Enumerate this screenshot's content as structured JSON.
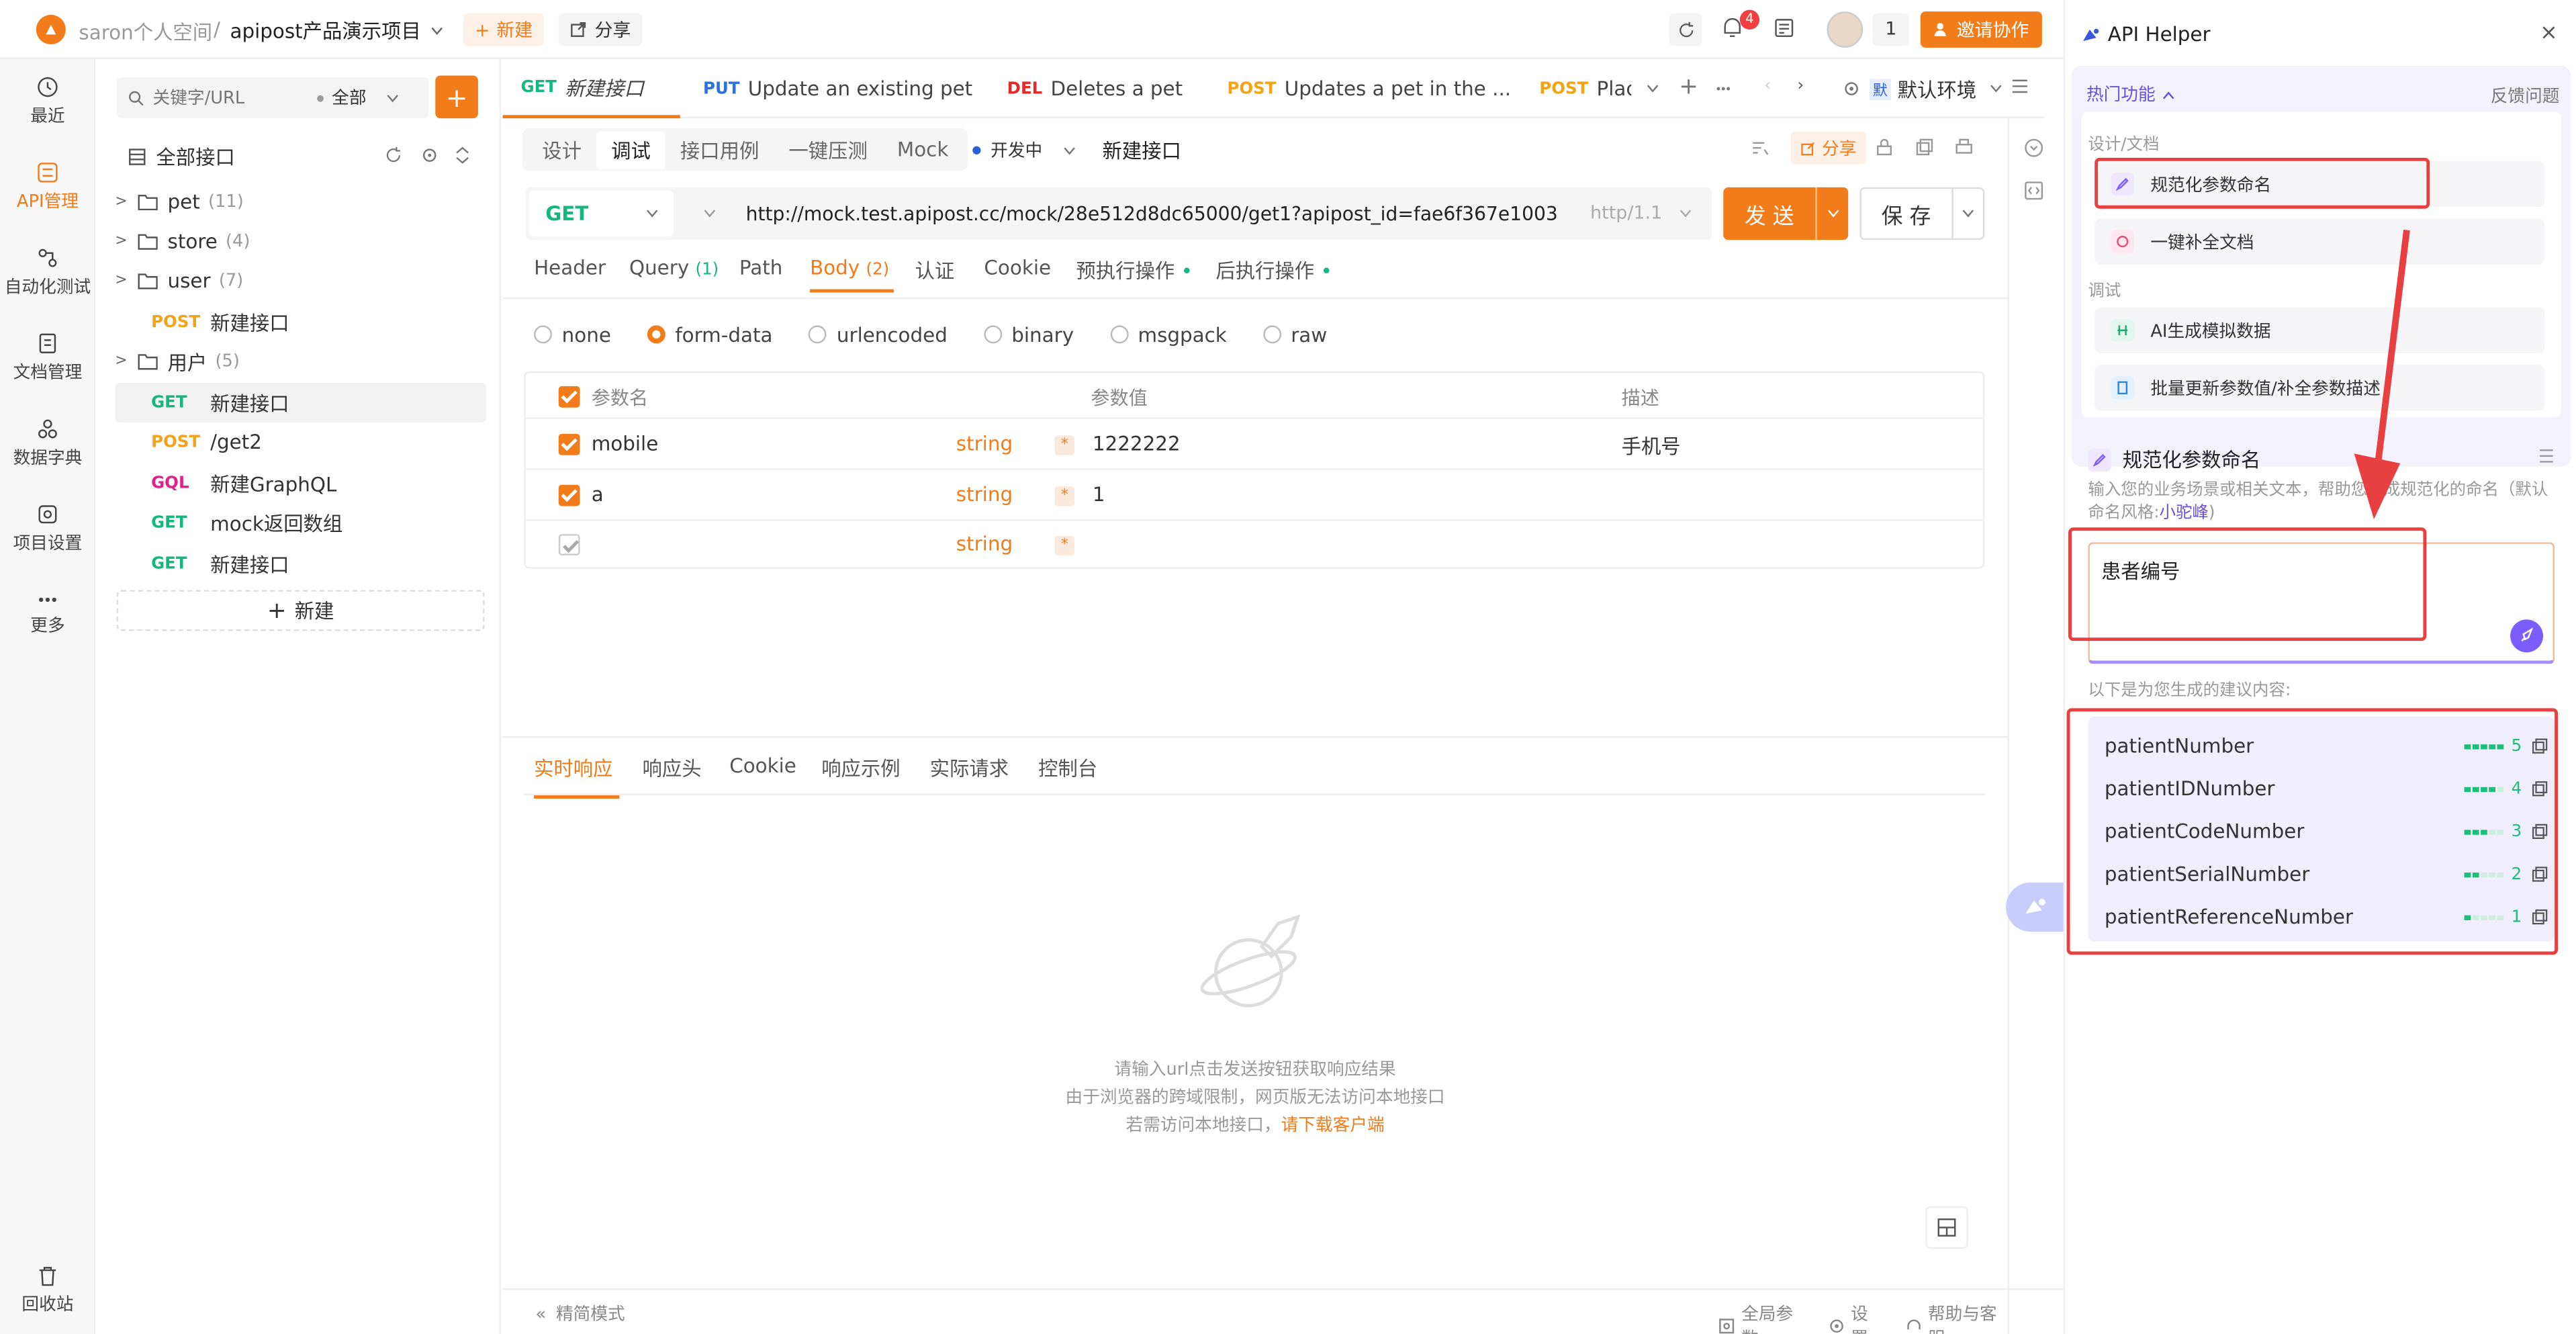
{
  "topbar": {
    "workspace": "saron个人空间",
    "sep": "/",
    "project": "apipost产品演示项目",
    "new_label": "新建",
    "share_label": "分享",
    "notify_count": "4",
    "member_count": "1",
    "invite_label": "邀请协作"
  },
  "sidebar": {
    "items": [
      {
        "label": "最近"
      },
      {
        "label": "API管理"
      },
      {
        "label": "自动化测试"
      },
      {
        "label": "文档管理"
      },
      {
        "label": "数据字典"
      },
      {
        "label": "项目设置"
      },
      {
        "label": "更多"
      }
    ],
    "trash": "回收站"
  },
  "tree": {
    "search_placeholder": "关键字/URL",
    "filter": "全部",
    "root": "全部接口",
    "rows": [
      {
        "name": "pet",
        "count": "(11)"
      },
      {
        "name": "store",
        "count": "(4)"
      },
      {
        "name": "user",
        "count": "(7)"
      },
      {
        "method": "POST",
        "name": "新建接口"
      },
      {
        "name": "用户",
        "count": "(5)"
      },
      {
        "method": "GET",
        "name": "新建接口"
      },
      {
        "method": "POST",
        "name": "/get2"
      },
      {
        "method": "GQL",
        "name": "新建GraphQL"
      },
      {
        "method": "GET",
        "name": "mock返回数组"
      },
      {
        "method": "GET",
        "name": "新建接口"
      }
    ],
    "new_label": "新建"
  },
  "tabs": [
    {
      "method": "GET",
      "name": "新建接口"
    },
    {
      "method": "PUT",
      "name": "Update an existing pet"
    },
    {
      "method": "DEL",
      "name": "Deletes a pet"
    },
    {
      "method": "POST",
      "name": "Updates a pet in the ..."
    },
    {
      "method": "POST",
      "name": "Plac"
    }
  ],
  "env": "默认环境",
  "subtabs": [
    "设计",
    "调试",
    "接口用例",
    "一键压测",
    "Mock"
  ],
  "status": "开发中",
  "api_name": "新建接口",
  "share_label": "分享",
  "request": {
    "method": "GET",
    "url": "http://mock.test.apipost.cc/mock/28e512d8dc65000/get1?apipost_id=fae6f367e1003",
    "protocol": "http/1.1",
    "send": "发 送",
    "save": "保 存"
  },
  "params_tabs": [
    {
      "label": "Header"
    },
    {
      "label": "Query",
      "count": "(1)"
    },
    {
      "label": "Path"
    },
    {
      "label": "Body",
      "count": "(2)"
    },
    {
      "label": "认证"
    },
    {
      "label": "Cookie"
    },
    {
      "label": "预执行操作"
    },
    {
      "label": "后执行操作"
    }
  ],
  "body_types": [
    "none",
    "form-data",
    "urlencoded",
    "binary",
    "msgpack",
    "raw"
  ],
  "table": {
    "headers": [
      "参数名",
      "参数值",
      "描述"
    ],
    "rows": [
      {
        "name": "mobile",
        "type": "string",
        "value": "1222222",
        "desc": "手机号"
      },
      {
        "name": "a",
        "type": "string",
        "value": "1",
        "desc": ""
      },
      {
        "name": "",
        "type": "string",
        "value": "",
        "desc": ""
      }
    ]
  },
  "resp_tabs": [
    "实时响应",
    "响应头",
    "Cookie",
    "响应示例",
    "实际请求",
    "控制台"
  ],
  "resp_hint": {
    "line1": "请输入url点击发送按钮获取响应结果",
    "line2": "由于浏览器的跨域限制，网页版无法访问本地接口",
    "line3": "若需访问本地接口，",
    "link": "请下载客户端"
  },
  "footer": {
    "simple": "精简模式",
    "global": "全局参数",
    "settings": "设置",
    "help": "帮助与客服"
  },
  "helper": {
    "title": "API Helper",
    "hot": "热门功能",
    "feedback": "反馈问题",
    "group1": "设计/文档",
    "item1": "规范化参数命名",
    "item2": "一键补全文档",
    "group2": "调试",
    "item3": "AI生成模拟数据",
    "item4": "批量更新参数值/补全参数描述",
    "section_title": "规范化参数命名",
    "desc": "输入您的业务场景或相关文本，帮助您生成规范化的命名（默认命名风格:",
    "desc_style": "小驼峰",
    "desc_end": ")",
    "input_value": "患者编号",
    "result_label": "以下是为您生成的建议内容:",
    "suggestions": [
      {
        "name": "patientNumber",
        "score": "5",
        "level": 5
      },
      {
        "name": "patientIDNumber",
        "score": "4",
        "level": 4
      },
      {
        "name": "patientCodeNumber",
        "score": "3",
        "level": 3
      },
      {
        "name": "patientSerialNumber",
        "score": "2",
        "level": 2
      },
      {
        "name": "patientReferenceNumber",
        "score": "1",
        "level": 1
      }
    ]
  },
  "colors": {
    "accent": "#f27b1a",
    "annotation": "#e84040",
    "purple": "#7b5cff"
  }
}
